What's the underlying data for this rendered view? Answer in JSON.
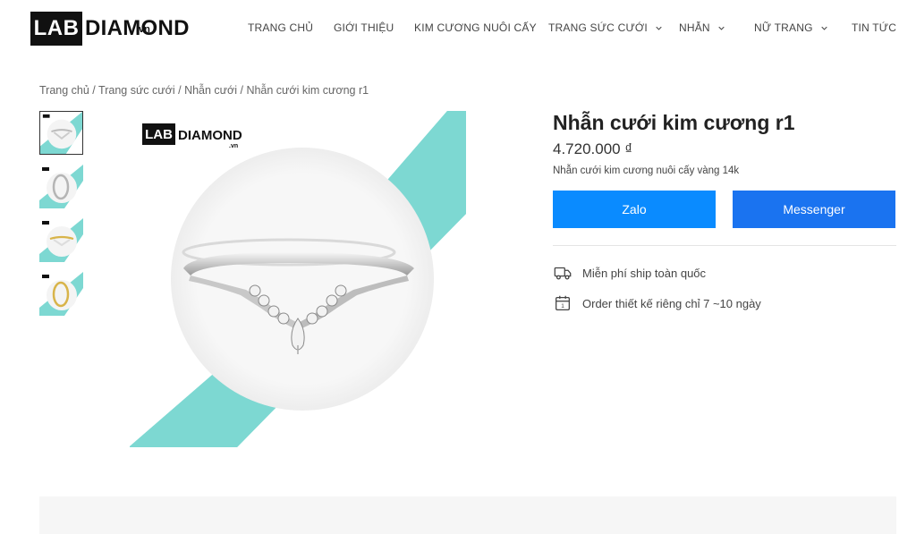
{
  "brand": {
    "lab": "LAB",
    "diamond": "DIAMOND",
    "tld": ".vn"
  },
  "nav": [
    {
      "label": "TRANG CHỦ",
      "dropdown": false
    },
    {
      "label": "GIỚI THIỆU",
      "dropdown": false
    },
    {
      "label": "KIM CƯƠNG NUÔI CẤY",
      "dropdown": false
    },
    {
      "label": "TRANG SỨC CƯỚI",
      "dropdown": true
    },
    {
      "label": "NHẪN",
      "dropdown": true
    },
    {
      "label": "NỮ TRANG",
      "dropdown": true
    },
    {
      "label": "TIN TỨC",
      "dropdown": false
    }
  ],
  "breadcrumb": {
    "home": "Trang chủ",
    "sep": " / ",
    "level1": "Trang sức cưới",
    "level2": "Nhẫn cưới",
    "current": "Nhẫn cưới kim cương r1"
  },
  "product": {
    "title": "Nhẫn cưới kim cương r1",
    "price": "4.720.000 ₫",
    "description": "Nhẫn cưới kim cương nuôi cấy vàng 14k"
  },
  "buttons": {
    "zalo": "Zalo",
    "messenger": "Messenger"
  },
  "features": [
    {
      "icon": "truck-icon",
      "text": "Miễn phí ship toàn quốc"
    },
    {
      "icon": "calendar-icon",
      "text": "Order thiết kế riêng chỉ 7 ~10 ngày"
    }
  ],
  "colors": {
    "accent_teal": "#7dd8d2",
    "zalo_blue": "#0a8bff",
    "messenger_blue": "#1a73f0"
  }
}
